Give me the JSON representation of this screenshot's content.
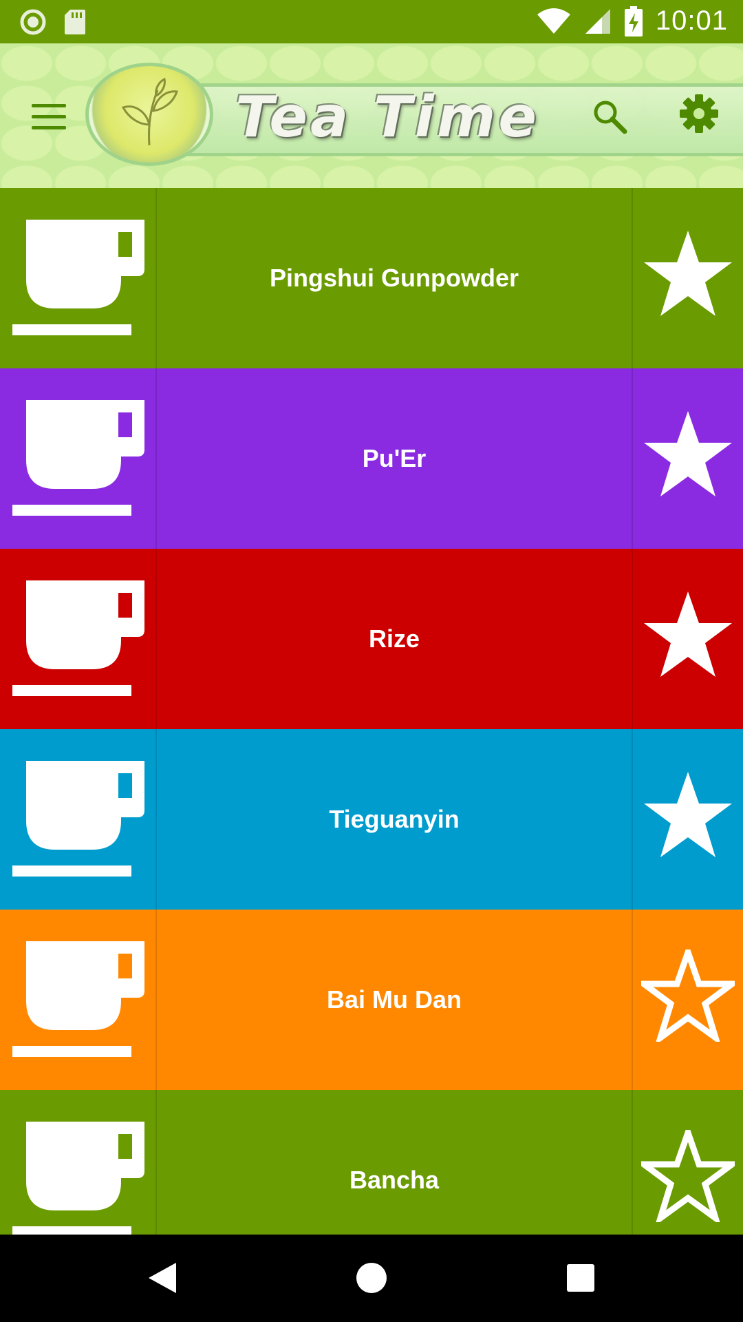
{
  "status_bar": {
    "time": "10:01",
    "icons": [
      "record-icon",
      "sd-card-icon",
      "wifi-icon",
      "cell-signal-icon",
      "battery-charging-icon"
    ]
  },
  "app_bar": {
    "title": "Tea Time",
    "logo": "tea-leaf-logo",
    "icons": [
      "hamburger-menu-icon",
      "search-icon",
      "gear-icon"
    ]
  },
  "teas": [
    {
      "name": "Pingshui Gunpowder",
      "color": "#6a9b00",
      "favorite": true
    },
    {
      "name": "Pu'Er",
      "color": "#8a2be2",
      "favorite": true
    },
    {
      "name": "Rize",
      "color": "#cc0000",
      "favorite": true
    },
    {
      "name": "Tieguanyin",
      "color": "#009ccd",
      "favorite": true
    },
    {
      "name": "Bai Mu Dan",
      "color": "#ff8800",
      "favorite": false
    },
    {
      "name": "Bancha",
      "color": "#6a9b00",
      "favorite": false
    }
  ],
  "nav_bar": {
    "icons": [
      "back-icon",
      "home-icon",
      "recents-icon"
    ]
  }
}
